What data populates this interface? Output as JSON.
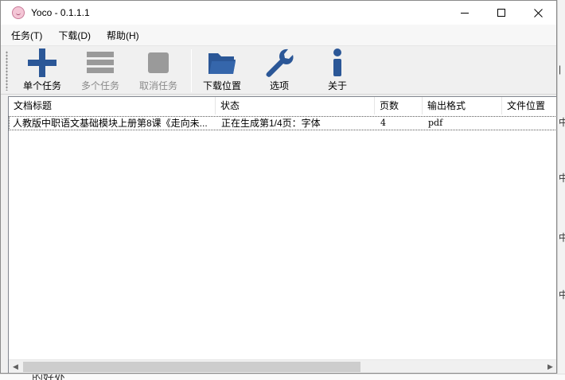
{
  "window": {
    "title": "Yoco - 0.1.1.1",
    "controls": {
      "minimize_icon": "minimize-icon",
      "maximize_icon": "maximize-icon",
      "close_icon": "close-icon"
    }
  },
  "menu": [
    {
      "label": "任务(T)"
    },
    {
      "label": "下载(D)"
    },
    {
      "label": "帮助(H)"
    }
  ],
  "toolbar": {
    "single_task": "单个任务",
    "multi_task": "多个任务",
    "cancel_task": "取消任务",
    "download_location": "下载位置",
    "options": "选项",
    "about": "关于"
  },
  "table": {
    "columns": [
      "文档标题",
      "状态",
      "页数",
      "输出格式",
      "文件位置"
    ],
    "rows": [
      {
        "title": "人教版中职语文基础模块上册第8课《走向未...",
        "status": "正在生成第1/4页：字体",
        "pages": "4",
        "format": "pdf",
        "location": ""
      }
    ]
  },
  "colors": {
    "accent": "#2b5797",
    "disabled": "#9a9a9a"
  }
}
